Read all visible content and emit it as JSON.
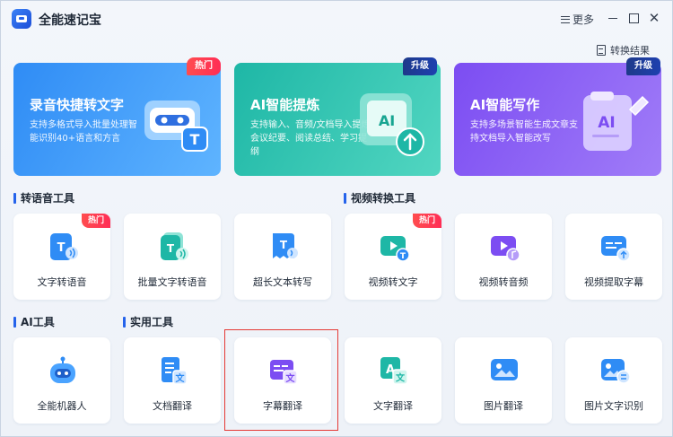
{
  "app": {
    "title": "全能速记宝"
  },
  "titlebar": {
    "more_label": "更多"
  },
  "toolbar": {
    "result_label": "转换结果"
  },
  "features": [
    {
      "title": "录音快捷转文字",
      "desc": "支持多格式导入批量处理智能识别40+语言和方言",
      "badge": "热门",
      "color": "#2f8cf5"
    },
    {
      "title": "AI智能提炼",
      "desc": "支持输入、音频/文档导入提炼会议纪要、阅读总结、学习提纲",
      "badge": "升级",
      "color": "#1eb7a6"
    },
    {
      "title": "AI智能写作",
      "desc": "支持多场景智能生成文章支持文档导入智能改写",
      "badge": "升级",
      "color": "#7c4df2"
    }
  ],
  "sections": {
    "speech": "转语音工具",
    "video": "视频转换工具",
    "ai": "AI工具",
    "utility": "实用工具"
  },
  "tools_row1": [
    {
      "label": "文字转语音",
      "badge": "热门",
      "icon": "text-to-speech-icon",
      "color": "#2f8cf5"
    },
    {
      "label": "批量文字转语音",
      "badge": "",
      "icon": "batch-text-to-speech-icon",
      "color": "#1eb7a6"
    },
    {
      "label": "超长文本转写",
      "badge": "",
      "icon": "long-text-icon",
      "color": "#2f8cf5"
    },
    {
      "label": "视频转文字",
      "badge": "热门",
      "icon": "video-to-text-icon",
      "color": "#1eb7a6"
    },
    {
      "label": "视频转音频",
      "badge": "",
      "icon": "video-to-audio-icon",
      "color": "#7c4df2"
    },
    {
      "label": "视频提取字幕",
      "badge": "",
      "icon": "video-subtitle-icon",
      "color": "#2f8cf5"
    }
  ],
  "tools_row2": [
    {
      "label": "全能机器人",
      "badge": "",
      "icon": "robot-icon",
      "color": "#2f8cf5"
    },
    {
      "label": "文档翻译",
      "badge": "",
      "icon": "doc-translate-icon",
      "color": "#2f8cf5"
    },
    {
      "label": "字幕翻译",
      "badge": "",
      "icon": "subtitle-translate-icon",
      "color": "#7c4df2"
    },
    {
      "label": "文字翻译",
      "badge": "",
      "icon": "text-translate-icon",
      "color": "#1eb7a6"
    },
    {
      "label": "图片翻译",
      "badge": "",
      "icon": "image-translate-icon",
      "color": "#2f8cf5"
    },
    {
      "label": "图片文字识别",
      "badge": "",
      "icon": "image-ocr-icon",
      "color": "#2f8cf5"
    }
  ],
  "icons": {
    "text_glyph": "T",
    "wen_glyph": "文",
    "ai_glyph": "AI",
    "close_glyph": "✕"
  }
}
